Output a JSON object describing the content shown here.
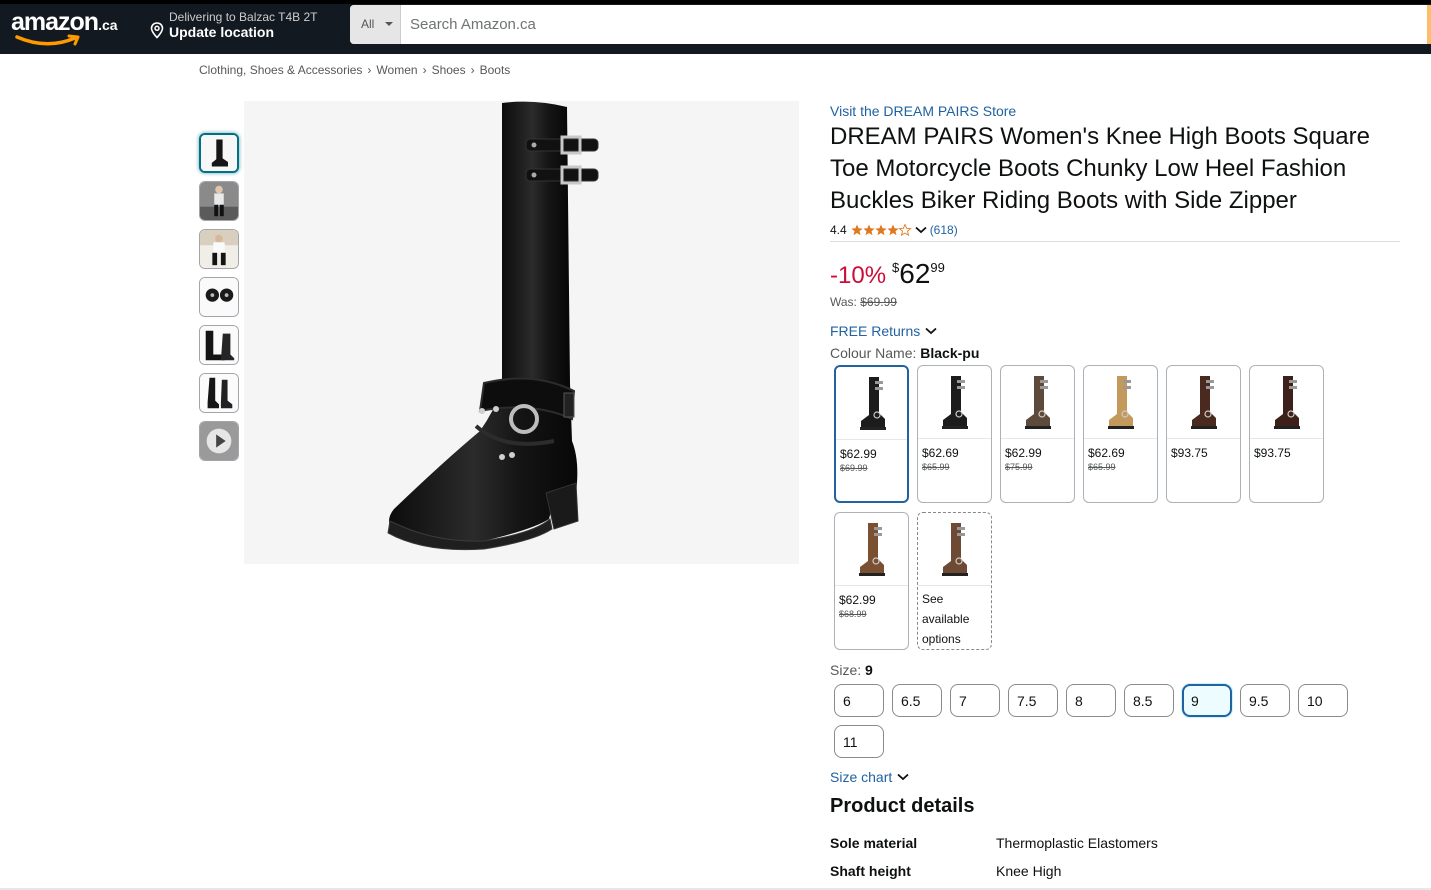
{
  "header": {
    "logo_text": "amazon",
    "logo_tld": ".ca",
    "deliver_line1": "Delivering to Balzac T4B 2T",
    "deliver_line2": "Update location",
    "search_category": "All",
    "search_placeholder": "Search Amazon.ca"
  },
  "breadcrumb": [
    "Clothing, Shoes & Accessories",
    "Women",
    "Shoes",
    "Boots"
  ],
  "product": {
    "store_link": "Visit the DREAM PAIRS Store",
    "title": "DREAM PAIRS Women's Knee High Boots Square Toe Motorcycle Boots Chunky Low Heel Fashion Buckles Biker Riding Boots with Side Zipper",
    "rating_value": "4.4",
    "rating_stars": 4.4,
    "rating_count": "(618)",
    "discount": "-10%",
    "price_symbol": "$",
    "price_whole": "62",
    "price_fraction": "99",
    "was_label": "Was:",
    "was_price": "$69.99",
    "free_returns": "FREE Returns",
    "colour_label": "Colour Name:",
    "colour_value": "Black-pu",
    "swatches": [
      {
        "price": "$62.99",
        "was": "$69.99",
        "color": "#1c1c1c",
        "selected": true
      },
      {
        "price": "$62.69",
        "was": "$65.99",
        "color": "#1c1c1c"
      },
      {
        "price": "$62.99",
        "was": "$75.99",
        "color": "#5e4a3a"
      },
      {
        "price": "$62.69",
        "was": "$65.99",
        "color": "#c49a5c"
      },
      {
        "price": "$93.75",
        "was": "",
        "color": "#4a2a1e"
      },
      {
        "price": "$93.75",
        "was": "",
        "color": "#3c2019"
      },
      {
        "price": "$62.99",
        "was": "$68.99",
        "color": "#7a4f32"
      },
      {
        "see": "See available options",
        "color": "#6e4a34"
      }
    ],
    "size_label": "Size:",
    "size_value": "9",
    "sizes": [
      "6",
      "6.5",
      "7",
      "7.5",
      "8",
      "8.5",
      "9",
      "9.5",
      "10",
      "11"
    ],
    "selected_size": "9",
    "size_chart": "Size chart",
    "details_heading": "Product details",
    "details": [
      {
        "key": "Sole material",
        "value": "Thermoplastic Elastomers"
      },
      {
        "key": "Shaft height",
        "value": "Knee High"
      }
    ]
  },
  "colors": {
    "header_bg": "#131921",
    "link": "#2162a1",
    "discount": "#cc0c39",
    "star": "#de7921"
  }
}
